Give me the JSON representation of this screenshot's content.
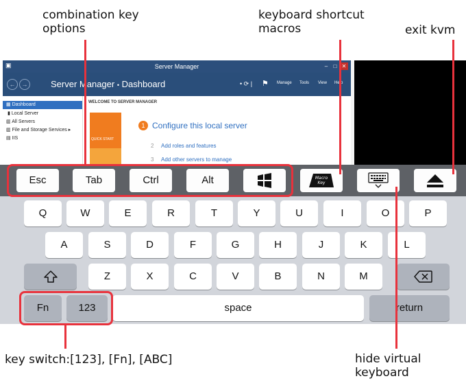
{
  "annotations": {
    "combination_keys": "combination key\noptions",
    "macros": "keyboard shortcut\nmacros",
    "exit_kvm": "exit kvm",
    "key_switch": "key switch:[123], [Fn], [ABC]",
    "hide_keyboard": "hide virtual\nkeyboard"
  },
  "server_manager": {
    "window_title": "Server Manager",
    "breadcrumb_app": "Server Manager",
    "breadcrumb_sep": "•",
    "breadcrumb_page": "Dashboard",
    "menu": [
      "Manage",
      "Tools",
      "View",
      "Help"
    ],
    "sidebar": [
      "Dashboard",
      "Local Server",
      "All Servers",
      "File and Storage Services",
      "IIS"
    ],
    "welcome": "WELCOME TO SERVER MANAGER",
    "quick_start": "QUICK START",
    "steps": [
      {
        "num": "1",
        "label": "Configure this local server"
      },
      {
        "num": "2",
        "label": "Add roles and features"
      },
      {
        "num": "3",
        "label": "Add other servers to manage"
      }
    ]
  },
  "toolbar": {
    "keys": [
      "Esc",
      "Tab",
      "Ctrl",
      "Alt"
    ],
    "windows_key_icon": "windows-logo-icon",
    "macro_key_icon": "macro-key-icon",
    "hide_keyboard_icon": "keyboard-hide-icon",
    "eject_icon": "eject-icon"
  },
  "keyboard": {
    "row1": [
      "Q",
      "W",
      "E",
      "R",
      "T",
      "Y",
      "U",
      "I",
      "O",
      "P"
    ],
    "row2": [
      "A",
      "S",
      "D",
      "F",
      "G",
      "H",
      "J",
      "K",
      "L"
    ],
    "row3": [
      "Z",
      "X",
      "C",
      "V",
      "B",
      "N",
      "M"
    ],
    "fn": "Fn",
    "num": "123",
    "space": "space",
    "return": "return"
  },
  "colors": {
    "highlight": "#e8323c",
    "toolbar": "#5e6166",
    "keyboard_bg": "#d2d5db",
    "accent_orange": "#f07c1f"
  }
}
